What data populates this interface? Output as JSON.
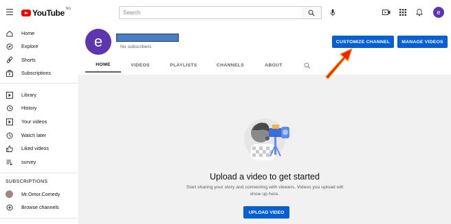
{
  "header": {
    "logo_text": "YouTube",
    "country_code": "NG",
    "search_placeholder": "Search",
    "avatar_letter": "e"
  },
  "sidebar": {
    "items": [
      {
        "label": "Home",
        "icon": "home-icon"
      },
      {
        "label": "Explore",
        "icon": "compass-icon"
      },
      {
        "label": "Shorts",
        "icon": "shorts-icon"
      },
      {
        "label": "Subscriptions",
        "icon": "subscriptions-icon"
      }
    ],
    "library_items": [
      {
        "label": "Library",
        "icon": "library-icon"
      },
      {
        "label": "History",
        "icon": "history-icon"
      },
      {
        "label": "Your videos",
        "icon": "your-videos-icon"
      },
      {
        "label": "Watch later",
        "icon": "clock-icon"
      },
      {
        "label": "Liked videos",
        "icon": "thumbs-up-icon"
      },
      {
        "label": "survey",
        "icon": "playlist-icon"
      }
    ],
    "subscriptions_heading": "SUBSCRIPTIONS",
    "subscriptions": [
      {
        "label": "Mr.Omor.Comedy"
      },
      {
        "label": "Browse channels",
        "icon": "add-circle-icon"
      }
    ]
  },
  "channel": {
    "avatar_letter": "e",
    "subscribers": "No subscribers",
    "customize_label": "CUSTOMIZE CHANNEL",
    "manage_label": "MANAGE VIDEOS",
    "tabs": [
      "HOME",
      "VIDEOS",
      "PLAYLISTS",
      "CHANNELS",
      "ABOUT"
    ]
  },
  "main": {
    "title": "Upload a video to get started",
    "description": "Start sharing your story and connecting with viewers. Videos you upload will show up here.",
    "upload_label": "UPLOAD VIDEO"
  },
  "colors": {
    "accent": "#065fd4",
    "avatar": "#5e35b1",
    "annotation_arrow": "#ff1a00"
  }
}
